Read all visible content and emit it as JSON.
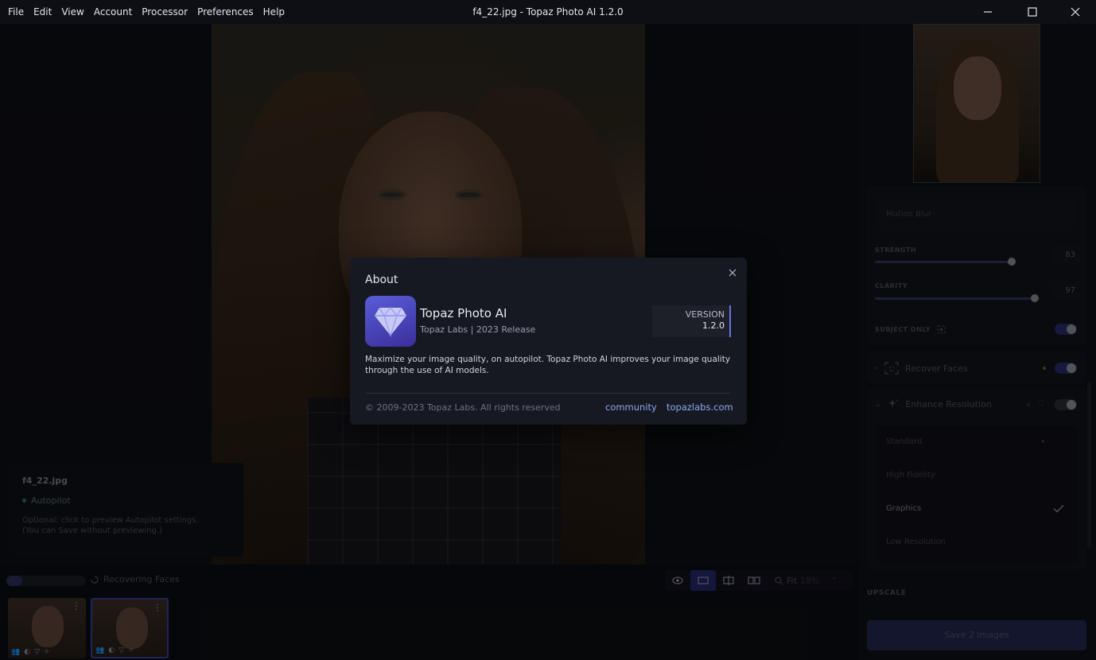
{
  "window": {
    "title": "f4_22.jpg - Topaz Photo AI 1.2.0",
    "menu": [
      "File",
      "Edit",
      "View",
      "Account",
      "Processor",
      "Preferences",
      "Help"
    ]
  },
  "image_info": {
    "filename": "f4_22.jpg",
    "autopilot_label": "Autopilot",
    "optional_note_line1": "Optional: click to preview Autopilot settings.",
    "optional_note_line2": "(You can Save without previewing.)"
  },
  "status": {
    "progress": 0.2,
    "activity_label": "Recovering Faces",
    "fit_label": "Fit",
    "zoom": "18%"
  },
  "thumbnails": [
    {
      "selected": false,
      "badges": [
        "👥",
        "◐",
        "▽",
        "✧"
      ]
    },
    {
      "selected": true,
      "badges": [
        "👥",
        "◐",
        "▽",
        "✧"
      ]
    }
  ],
  "right_panel": {
    "motion_blur_label": "Motion Blur",
    "strength": {
      "label": "STRENGTH",
      "value": "83",
      "level": 0.83
    },
    "clarity": {
      "label": "CLARITY",
      "value": "97",
      "level": 0.97
    },
    "subject_only": {
      "label": "SUBJECT ONLY",
      "on": true
    },
    "recover_faces": {
      "label": "Recover Faces",
      "on": true
    },
    "enhance_resolution": {
      "label": "Enhance Resolution",
      "on": false
    },
    "model_options": [
      "Standard",
      "High Fidelity",
      "Graphics",
      "Low Resolution"
    ],
    "selected_model": "Graphics",
    "upscale_label": "UPSCALE",
    "save_label": "Save 2 Images"
  },
  "about": {
    "title": "About",
    "app_name": "Topaz Photo AI",
    "app_sub": "Topaz Labs | 2023 Release",
    "version_label": "VERSION",
    "version": "1.2.0",
    "description": "Maximize your image quality, on autopilot. Topaz Photo AI improves your image quality through the use of AI models.",
    "copyright": "© 2009-2023 Topaz Labs. All rights reserved",
    "links": [
      "community",
      "topazlabs.com"
    ]
  },
  "colors": {
    "accent": "#6b70e8",
    "link": "#8fa7f2",
    "background": "#0c0d12",
    "dialog": "#171922"
  }
}
